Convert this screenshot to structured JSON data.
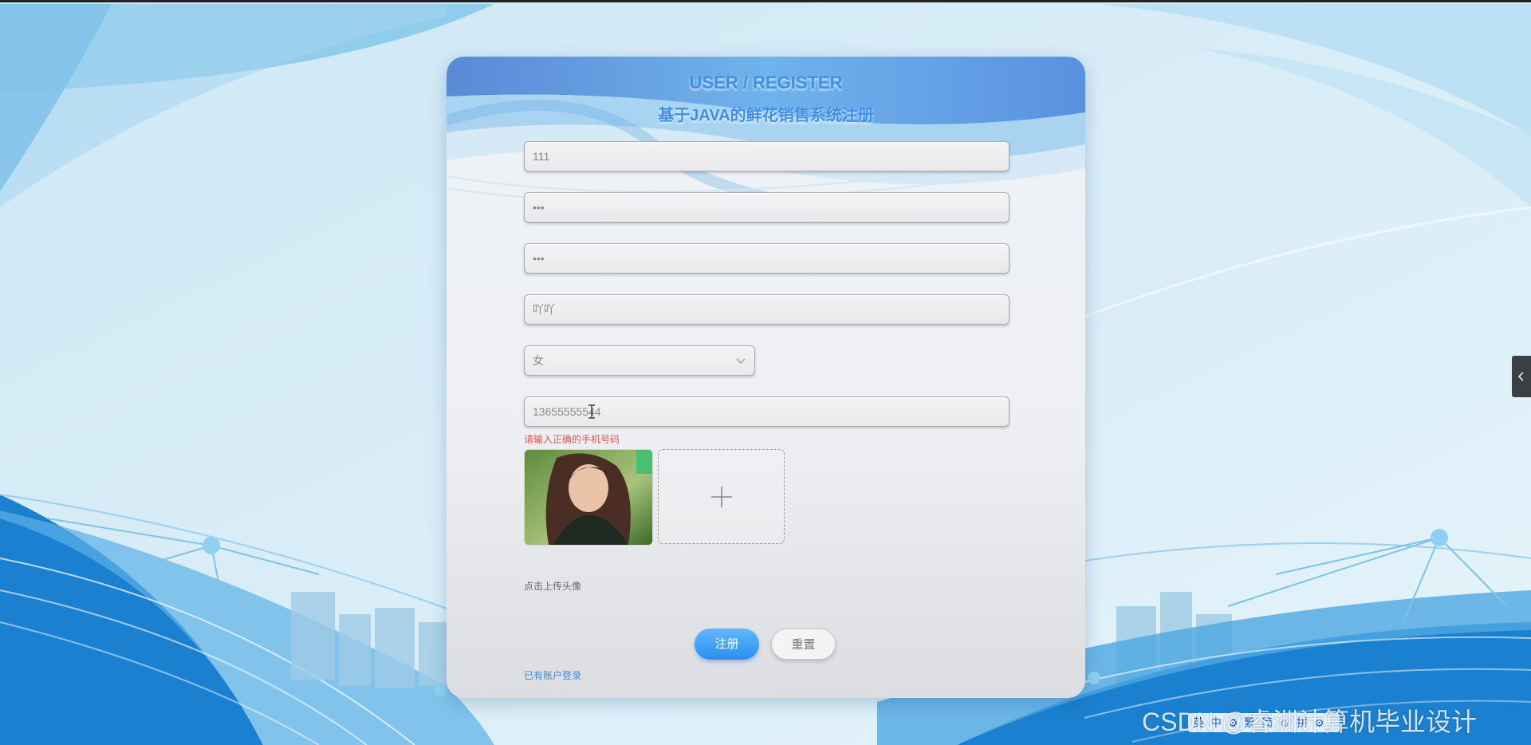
{
  "header": {
    "title_en": "USER / REGISTER",
    "title_cn": "基于JAVA的鲜花销售系统注册"
  },
  "form": {
    "account": "111",
    "password": "•••",
    "confirm_password": "•••",
    "name": "吖吖",
    "gender": "女",
    "phone": "13655555544",
    "phone_error": "请输入正确的手机号码",
    "avatar_hint": "点击上传头像"
  },
  "buttons": {
    "register": "注册",
    "reset": "重置"
  },
  "links": {
    "login": "已有账户登录"
  },
  "overlay": {
    "watermark": "CSDN @睿洲计算机毕业设计",
    "ime_toolbar": "英 中 ⚙ 繁 简 ☺ 拼 ⚙"
  },
  "icons": {
    "dropdown": "chevron-down-icon",
    "upload": "plus-icon",
    "side_panel": "chevron-left-icon",
    "text_cursor": "text-cursor-icon"
  },
  "colors": {
    "accent": "#3c90e8",
    "primary_button": "#2b8ff0",
    "error": "#e8554f"
  }
}
